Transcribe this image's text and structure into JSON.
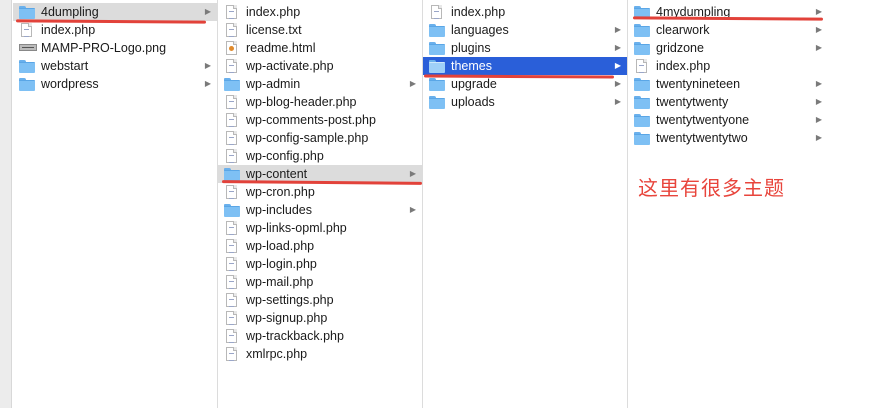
{
  "columns": [
    {
      "items": [
        {
          "label": "4dumpling",
          "type": "folder",
          "arrow": true,
          "state": "grey"
        },
        {
          "label": "index.php",
          "type": "file",
          "arrow": false
        },
        {
          "label": "MAMP-PRO-Logo.png",
          "type": "png",
          "arrow": false
        },
        {
          "label": "webstart",
          "type": "folder",
          "arrow": true
        },
        {
          "label": "wordpress",
          "type": "folder",
          "arrow": true
        }
      ]
    },
    {
      "items": [
        {
          "label": "index.php",
          "type": "file",
          "arrow": false
        },
        {
          "label": "license.txt",
          "type": "file",
          "arrow": false
        },
        {
          "label": "readme.html",
          "type": "html",
          "arrow": false
        },
        {
          "label": "wp-activate.php",
          "type": "file",
          "arrow": false
        },
        {
          "label": "wp-admin",
          "type": "folder",
          "arrow": true
        },
        {
          "label": "wp-blog-header.php",
          "type": "file",
          "arrow": false
        },
        {
          "label": "wp-comments-post.php",
          "type": "file",
          "arrow": false
        },
        {
          "label": "wp-config-sample.php",
          "type": "file",
          "arrow": false
        },
        {
          "label": "wp-config.php",
          "type": "file",
          "arrow": false
        },
        {
          "label": "wp-content",
          "type": "folder",
          "arrow": true,
          "state": "grey"
        },
        {
          "label": "wp-cron.php",
          "type": "file",
          "arrow": false
        },
        {
          "label": "wp-includes",
          "type": "folder",
          "arrow": true
        },
        {
          "label": "wp-links-opml.php",
          "type": "file",
          "arrow": false
        },
        {
          "label": "wp-load.php",
          "type": "file",
          "arrow": false
        },
        {
          "label": "wp-login.php",
          "type": "file",
          "arrow": false
        },
        {
          "label": "wp-mail.php",
          "type": "file",
          "arrow": false
        },
        {
          "label": "wp-settings.php",
          "type": "file",
          "arrow": false
        },
        {
          "label": "wp-signup.php",
          "type": "file",
          "arrow": false
        },
        {
          "label": "wp-trackback.php",
          "type": "file",
          "arrow": false
        },
        {
          "label": "xmlrpc.php",
          "type": "file",
          "arrow": false
        }
      ]
    },
    {
      "items": [
        {
          "label": "index.php",
          "type": "file",
          "arrow": false
        },
        {
          "label": "languages",
          "type": "folder",
          "arrow": true
        },
        {
          "label": "plugins",
          "type": "folder",
          "arrow": true
        },
        {
          "label": "themes",
          "type": "folder",
          "arrow": true,
          "state": "blue"
        },
        {
          "label": "upgrade",
          "type": "folder",
          "arrow": true
        },
        {
          "label": "uploads",
          "type": "folder",
          "arrow": true
        }
      ]
    },
    {
      "items": [
        {
          "label": "4mydumpling",
          "type": "folder",
          "arrow": true
        },
        {
          "label": "clearwork",
          "type": "folder",
          "arrow": true
        },
        {
          "label": "gridzone",
          "type": "folder",
          "arrow": true
        },
        {
          "label": "index.php",
          "type": "file",
          "arrow": false
        },
        {
          "label": "twentynineteen",
          "type": "folder",
          "arrow": true
        },
        {
          "label": "twentytwenty",
          "type": "folder",
          "arrow": true
        },
        {
          "label": "twentytwentyone",
          "type": "folder",
          "arrow": true
        },
        {
          "label": "twentytwentytwo",
          "type": "folder",
          "arrow": true
        }
      ]
    }
  ],
  "annotation_note": "这里有很多主题",
  "colors": {
    "selection_blue": "#2a5fd9",
    "selection_grey": "#dcdcdc",
    "annotation_red": "#e2423a"
  },
  "icons": {
    "folder": "folder-icon",
    "file": "php-file-icon",
    "html": "html-file-icon",
    "png": "png-image-icon",
    "arrow": "chevron-right-icon"
  }
}
